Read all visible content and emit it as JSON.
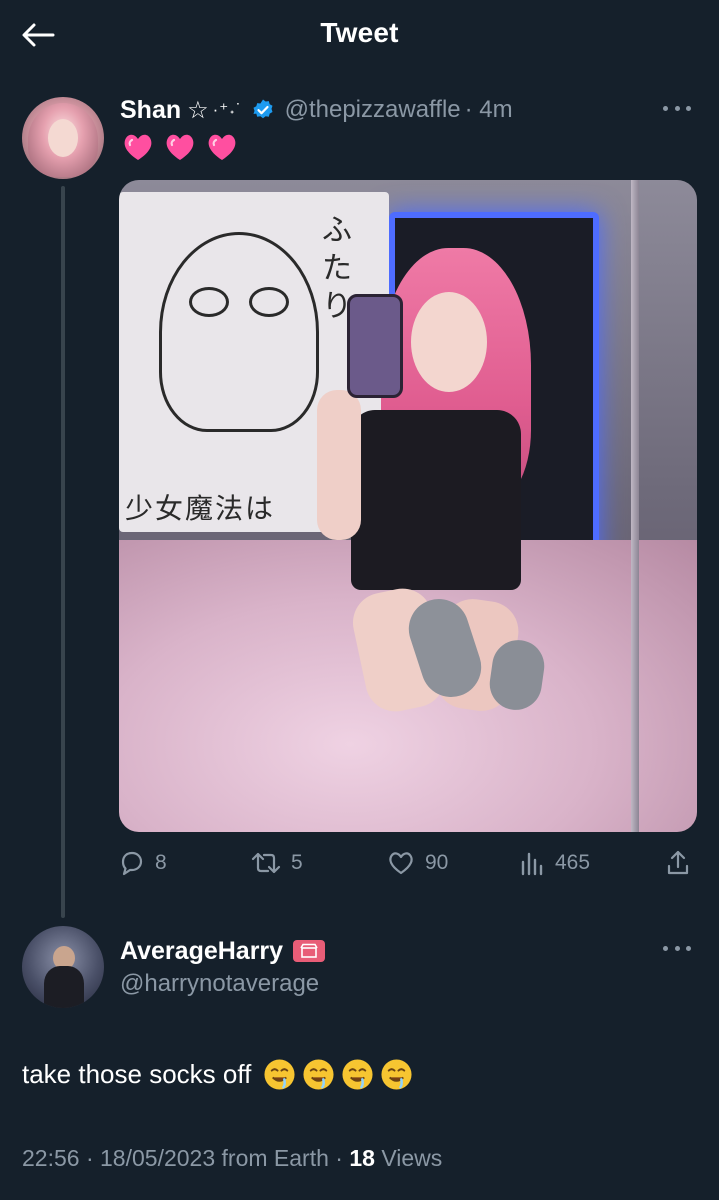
{
  "header": {
    "title": "Tweet"
  },
  "tweet": {
    "display_name": "Shan",
    "name_decor_star": "☆",
    "name_decor_sparkle": "·⁺˖˙",
    "handle": "@thepizzawaffle",
    "time": "· 4m",
    "text_emojis": [
      "pink-heart",
      "pink-heart",
      "pink-heart"
    ],
    "stats": {
      "replies": "8",
      "retweets": "5",
      "likes": "90",
      "views": "465"
    }
  },
  "reply": {
    "display_name": "AverageHarry",
    "handle": "@harrynotaverage",
    "text": "take those socks off",
    "emojis": [
      "drooling-face",
      "drooling-face",
      "drooling-face",
      "drooling-face"
    ],
    "meta": {
      "time": "22:56",
      "date": "18/05/2023",
      "source": "from Earth",
      "views_count": "18",
      "views_label": "Views",
      "sep": " · "
    }
  },
  "media": {
    "tapestry_text": "少女魔法は",
    "tapestry_vertical": "ふたり"
  },
  "colors": {
    "background": "#15202b",
    "secondary_text": "#8b98a5",
    "verified_blue": "#1d9bf0",
    "heart_pink": "#ff4fa0",
    "thread_line": "#38444d"
  }
}
